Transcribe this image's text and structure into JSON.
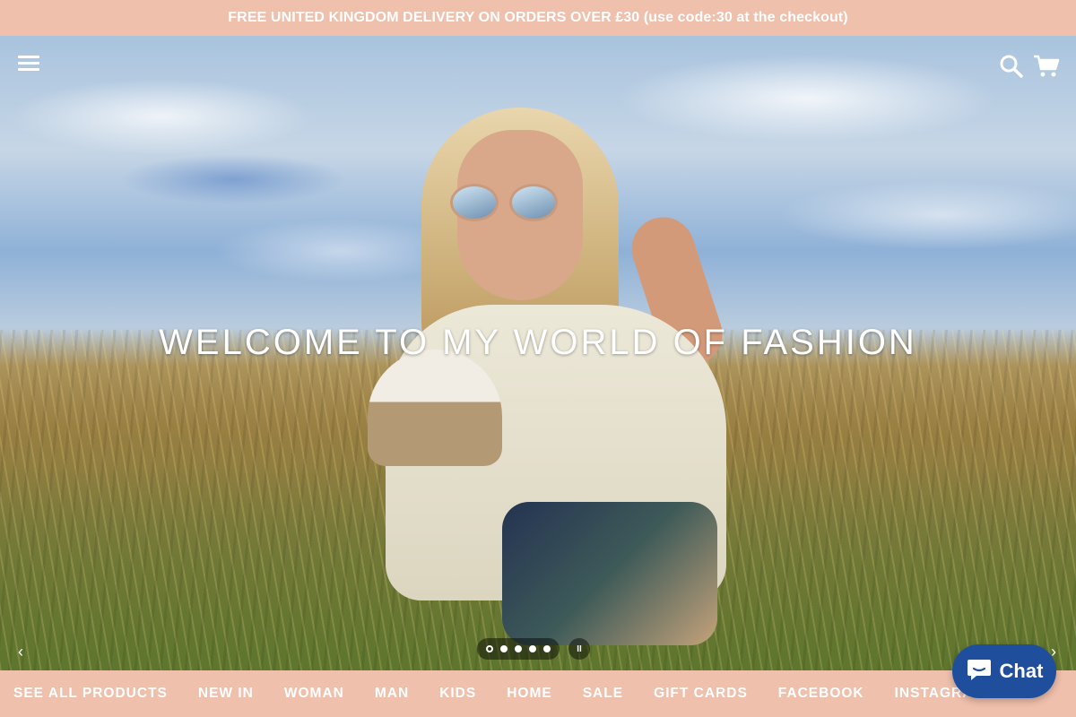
{
  "announcement": {
    "text": "FREE UNITED KINGDOM DELIVERY ON ORDERS OVER £30 (use code:30 at the checkout)"
  },
  "hero": {
    "title": "WELCOME TO MY WORLD OF FASHION",
    "prev_arrow": "‹",
    "next_arrow": "›",
    "slide_count": 5,
    "active_slide": 1,
    "pause_label": "II"
  },
  "header": {
    "icons": [
      "menu-icon",
      "search-icon",
      "cart-icon"
    ]
  },
  "bottom_nav": {
    "items": [
      {
        "label": "SEE ALL PRODUCTS"
      },
      {
        "label": "NEW IN"
      },
      {
        "label": "WOMAN"
      },
      {
        "label": "MAN"
      },
      {
        "label": "KIDS"
      },
      {
        "label": "HOME"
      },
      {
        "label": "SALE"
      },
      {
        "label": "GIFT CARDS"
      },
      {
        "label": "FACEBOOK"
      },
      {
        "label": "INSTAGRAM"
      }
    ]
  },
  "chat": {
    "label": "Chat",
    "icon": "chat-bubble-icon"
  },
  "colors": {
    "accent": "#efc0ac",
    "chat_button": "#1f4e9c",
    "text_on_accent": "#ffffff"
  }
}
